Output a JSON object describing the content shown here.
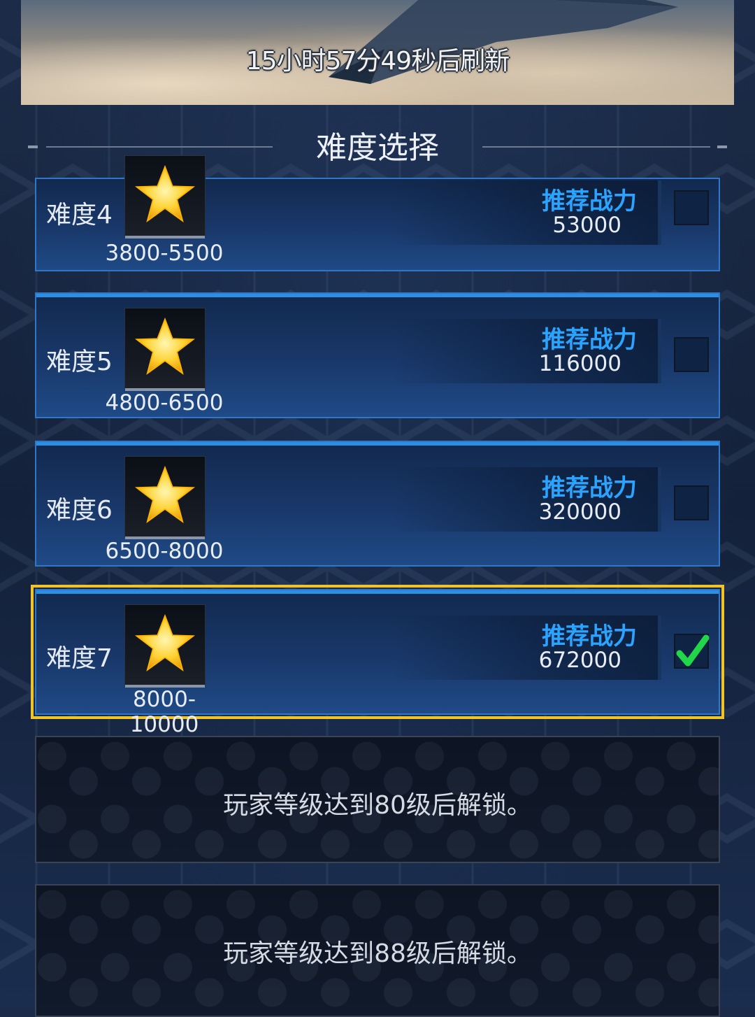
{
  "banner": {
    "refresh_text": "15小时57分49秒后刷新"
  },
  "section": {
    "title": "难度选择"
  },
  "difficulties": [
    {
      "label": "难度4",
      "range": "3800-5500",
      "power_title": "推荐战力",
      "power_value": "53000",
      "selected": false
    },
    {
      "label": "难度5",
      "range": "4800-6500",
      "power_title": "推荐战力",
      "power_value": "116000",
      "selected": false
    },
    {
      "label": "难度6",
      "range": "6500-8000",
      "power_title": "推荐战力",
      "power_value": "320000",
      "selected": false
    },
    {
      "label": "难度7",
      "range": "8000-10000",
      "power_title": "推荐战力",
      "power_value": "672000",
      "selected": true
    }
  ],
  "locked": [
    {
      "message": "玩家等级达到80级后解锁。"
    },
    {
      "message": "玩家等级达到88级后解锁。"
    }
  ],
  "icons": {
    "star": "star-icon",
    "check": "checkmark-icon"
  },
  "colors": {
    "accent_blue": "#2aa4ff",
    "selected_border": "#f0c427",
    "check_green": "#22d64a",
    "star_gold": "#ffd233"
  }
}
